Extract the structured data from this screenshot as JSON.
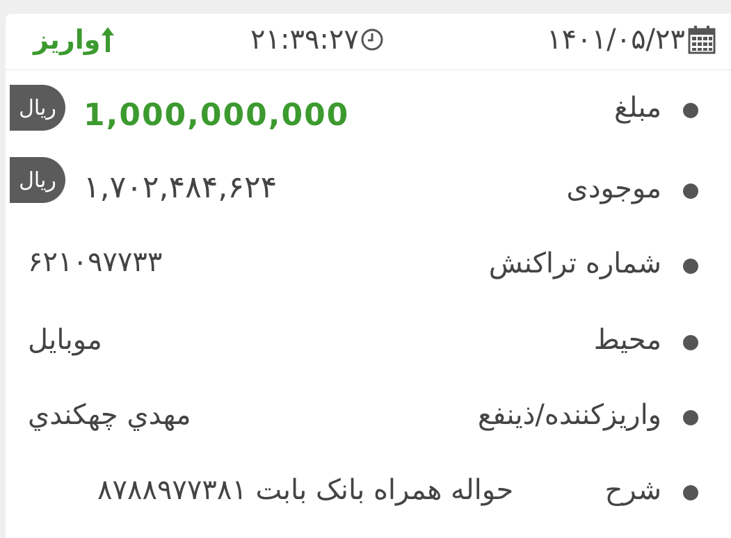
{
  "header": {
    "date": "۱۴۰۱/۰۵/۲۳",
    "time": "۲۱:۳۹:۲۷",
    "transaction_type": "واریز"
  },
  "rows": {
    "amount": {
      "label": "مبلغ",
      "value": "1,000,000,000",
      "unit": "ریال"
    },
    "balance": {
      "label": "موجودی",
      "value": "۱,۷۰۲,۴۸۴,۶۲۴",
      "unit": "ریال"
    },
    "tx_number": {
      "label": "شماره تراکنش",
      "value": "۶۲۱۰۹۷۷۳۳"
    },
    "channel": {
      "label": "محیط",
      "value": "موبایل"
    },
    "depositor": {
      "label": "واریزکننده/ذینفع",
      "value": "مهدي چهكندي"
    },
    "description": {
      "label": "شرح",
      "value": "حواله همراه بانک بابت  ۸۷۸۸۹۷۷۳۸۱"
    }
  },
  "colors": {
    "accent_green": "#3c9a2f",
    "text": "#444444",
    "badge_bg": "#5b5b5b"
  },
  "icons": [
    "calendar-icon",
    "clock-icon",
    "arrow-up-icon"
  ]
}
